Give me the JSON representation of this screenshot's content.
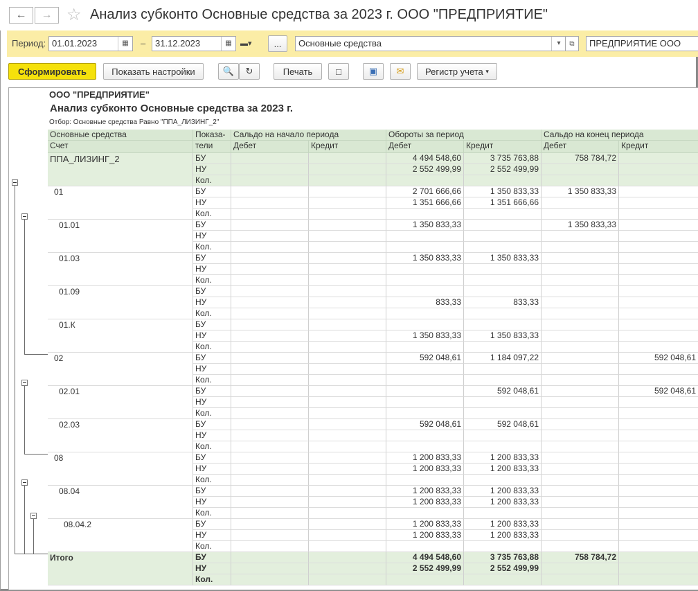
{
  "window": {
    "title": "Анализ субконто Основные средства за 2023 г. ООО \"ПРЕДПРИЯТИЕ\""
  },
  "period": {
    "label": "Период:",
    "from": "01.01.2023",
    "separator": "–",
    "to": "31.12.2023",
    "ellipsis": "...",
    "subconto": "Основные средства",
    "organization": "ПРЕДПРИЯТИЕ ООО"
  },
  "toolbar": {
    "generate": "Сформировать",
    "show_settings": "Показать настройки",
    "print": "Печать",
    "register": "Регистр учета"
  },
  "report": {
    "org": "ООО \"ПРЕДПРИЯТИЕ\"",
    "title": "Анализ субконто Основные средства за 2023 г.",
    "filter": "Отбор: Основные средства Равно \"ППА_ЛИЗИНГ_2\"",
    "headers": {
      "col_main": "Основные средства",
      "col_account": "Счет",
      "col_ind_1": "Показа-",
      "col_ind_2": "тели",
      "opening": "Сальдо на начало периода",
      "turnover": "Обороты за период",
      "closing": "Сальдо на конец периода",
      "debit": "Дебет",
      "credit": "Кредит"
    },
    "groups": [
      {
        "name": "ППА_ЛИЗИНГ_2",
        "indent": 0,
        "green": true,
        "rows": [
          {
            "ind": "БУ",
            "od": "",
            "oc": "",
            "td": "4 494 548,60",
            "tc": "3 735 763,88",
            "cd": "758 784,72",
            "cc": ""
          },
          {
            "ind": "НУ",
            "od": "",
            "oc": "",
            "td": "2 552 499,99",
            "tc": "2 552 499,99",
            "cd": "",
            "cc": ""
          },
          {
            "ind": "Кол.",
            "od": "",
            "oc": "",
            "td": "",
            "tc": "",
            "cd": "",
            "cc": ""
          }
        ]
      },
      {
        "name": "01",
        "indent": 1,
        "rows": [
          {
            "ind": "БУ",
            "od": "",
            "oc": "",
            "td": "2 701 666,66",
            "tc": "1 350 833,33",
            "cd": "1 350 833,33",
            "cc": ""
          },
          {
            "ind": "НУ",
            "od": "",
            "oc": "",
            "td": "1 351 666,66",
            "tc": "1 351 666,66",
            "cd": "",
            "cc": ""
          },
          {
            "ind": "Кол.",
            "od": "",
            "oc": "",
            "td": "",
            "tc": "",
            "cd": "",
            "cc": ""
          }
        ]
      },
      {
        "name": "01.01",
        "indent": 2,
        "rows": [
          {
            "ind": "БУ",
            "od": "",
            "oc": "",
            "td": "1 350 833,33",
            "tc": "",
            "cd": "1 350 833,33",
            "cc": ""
          },
          {
            "ind": "НУ",
            "od": "",
            "oc": "",
            "td": "",
            "tc": "",
            "cd": "",
            "cc": ""
          },
          {
            "ind": "Кол.",
            "od": "",
            "oc": "",
            "td": "",
            "tc": "",
            "cd": "",
            "cc": ""
          }
        ]
      },
      {
        "name": "01.03",
        "indent": 2,
        "rows": [
          {
            "ind": "БУ",
            "od": "",
            "oc": "",
            "td": "1 350 833,33",
            "tc": "1 350 833,33",
            "cd": "",
            "cc": ""
          },
          {
            "ind": "НУ",
            "od": "",
            "oc": "",
            "td": "",
            "tc": "",
            "cd": "",
            "cc": ""
          },
          {
            "ind": "Кол.",
            "od": "",
            "oc": "",
            "td": "",
            "tc": "",
            "cd": "",
            "cc": ""
          }
        ]
      },
      {
        "name": "01.09",
        "indent": 2,
        "rows": [
          {
            "ind": "БУ",
            "od": "",
            "oc": "",
            "td": "",
            "tc": "",
            "cd": "",
            "cc": ""
          },
          {
            "ind": "НУ",
            "od": "",
            "oc": "",
            "td": "833,33",
            "tc": "833,33",
            "cd": "",
            "cc": ""
          },
          {
            "ind": "Кол.",
            "od": "",
            "oc": "",
            "td": "",
            "tc": "",
            "cd": "",
            "cc": ""
          }
        ]
      },
      {
        "name": "01.К",
        "indent": 2,
        "rows": [
          {
            "ind": "БУ",
            "od": "",
            "oc": "",
            "td": "",
            "tc": "",
            "cd": "",
            "cc": ""
          },
          {
            "ind": "НУ",
            "od": "",
            "oc": "",
            "td": "1 350 833,33",
            "tc": "1 350 833,33",
            "cd": "",
            "cc": ""
          },
          {
            "ind": "Кол.",
            "od": "",
            "oc": "",
            "td": "",
            "tc": "",
            "cd": "",
            "cc": ""
          }
        ]
      },
      {
        "name": "02",
        "indent": 1,
        "rows": [
          {
            "ind": "БУ",
            "od": "",
            "oc": "",
            "td": "592 048,61",
            "tc": "1 184 097,22",
            "cd": "",
            "cc": "592 048,61"
          },
          {
            "ind": "НУ",
            "od": "",
            "oc": "",
            "td": "",
            "tc": "",
            "cd": "",
            "cc": ""
          },
          {
            "ind": "Кол.",
            "od": "",
            "oc": "",
            "td": "",
            "tc": "",
            "cd": "",
            "cc": ""
          }
        ]
      },
      {
        "name": "02.01",
        "indent": 2,
        "rows": [
          {
            "ind": "БУ",
            "od": "",
            "oc": "",
            "td": "",
            "tc": "592 048,61",
            "cd": "",
            "cc": "592 048,61"
          },
          {
            "ind": "НУ",
            "od": "",
            "oc": "",
            "td": "",
            "tc": "",
            "cd": "",
            "cc": ""
          },
          {
            "ind": "Кол.",
            "od": "",
            "oc": "",
            "td": "",
            "tc": "",
            "cd": "",
            "cc": ""
          }
        ]
      },
      {
        "name": "02.03",
        "indent": 2,
        "rows": [
          {
            "ind": "БУ",
            "od": "",
            "oc": "",
            "td": "592 048,61",
            "tc": "592 048,61",
            "cd": "",
            "cc": ""
          },
          {
            "ind": "НУ",
            "od": "",
            "oc": "",
            "td": "",
            "tc": "",
            "cd": "",
            "cc": ""
          },
          {
            "ind": "Кол.",
            "od": "",
            "oc": "",
            "td": "",
            "tc": "",
            "cd": "",
            "cc": ""
          }
        ]
      },
      {
        "name": "08",
        "indent": 1,
        "rows": [
          {
            "ind": "БУ",
            "od": "",
            "oc": "",
            "td": "1 200 833,33",
            "tc": "1 200 833,33",
            "cd": "",
            "cc": ""
          },
          {
            "ind": "НУ",
            "od": "",
            "oc": "",
            "td": "1 200 833,33",
            "tc": "1 200 833,33",
            "cd": "",
            "cc": ""
          },
          {
            "ind": "Кол.",
            "od": "",
            "oc": "",
            "td": "",
            "tc": "",
            "cd": "",
            "cc": ""
          }
        ]
      },
      {
        "name": "08.04",
        "indent": 2,
        "rows": [
          {
            "ind": "БУ",
            "od": "",
            "oc": "",
            "td": "1 200 833,33",
            "tc": "1 200 833,33",
            "cd": "",
            "cc": ""
          },
          {
            "ind": "НУ",
            "od": "",
            "oc": "",
            "td": "1 200 833,33",
            "tc": "1 200 833,33",
            "cd": "",
            "cc": ""
          },
          {
            "ind": "Кол.",
            "od": "",
            "oc": "",
            "td": "",
            "tc": "",
            "cd": "",
            "cc": ""
          }
        ]
      },
      {
        "name": "08.04.2",
        "indent": 3,
        "rows": [
          {
            "ind": "БУ",
            "od": "",
            "oc": "",
            "td": "1 200 833,33",
            "tc": "1 200 833,33",
            "cd": "",
            "cc": ""
          },
          {
            "ind": "НУ",
            "od": "",
            "oc": "",
            "td": "1 200 833,33",
            "tc": "1 200 833,33",
            "cd": "",
            "cc": ""
          },
          {
            "ind": "Кол.",
            "od": "",
            "oc": "",
            "td": "",
            "tc": "",
            "cd": "",
            "cc": ""
          }
        ]
      },
      {
        "name": "Итого",
        "indent": 0,
        "green": true,
        "total": true,
        "rows": [
          {
            "ind": "БУ",
            "od": "",
            "oc": "",
            "td": "4 494 548,60",
            "tc": "3 735 763,88",
            "cd": "758 784,72",
            "cc": ""
          },
          {
            "ind": "НУ",
            "od": "",
            "oc": "",
            "td": "2 552 499,99",
            "tc": "2 552 499,99",
            "cd": "",
            "cc": ""
          },
          {
            "ind": "Кол.",
            "od": "",
            "oc": "",
            "td": "",
            "tc": "",
            "cd": "",
            "cc": ""
          }
        ]
      }
    ]
  }
}
